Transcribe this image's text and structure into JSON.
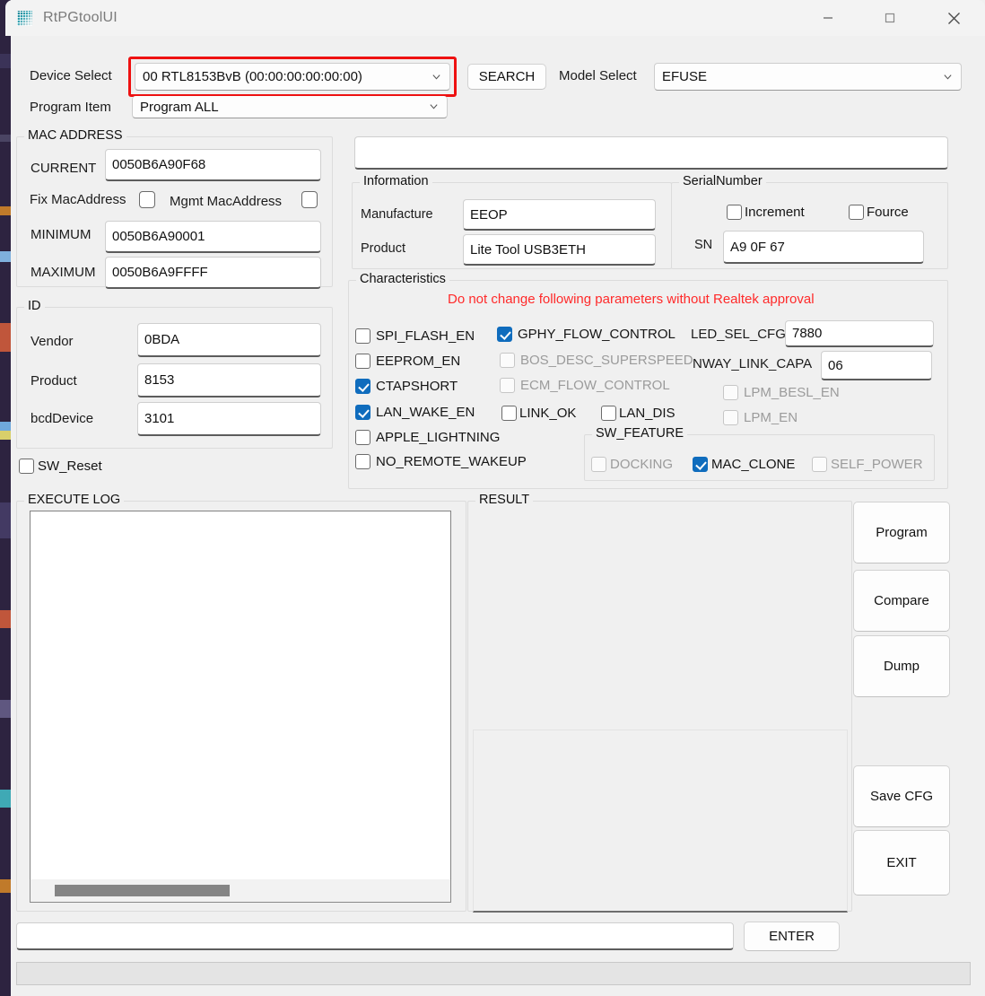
{
  "window": {
    "title": "RtPGtoolUI",
    "icon": "app-grid-icon",
    "controls": {
      "minimize": "—",
      "maximize": "☐",
      "close": "✕"
    }
  },
  "toolbar": {
    "device_select_label": "Device Select",
    "device_select_value": "00 RTL8153BvB (00:00:00:00:00:00)",
    "search_button": "SEARCH",
    "model_select_label": "Model Select",
    "model_select_value": "EFUSE",
    "program_item_label": "Program Item",
    "program_item_value": "Program ALL",
    "highlight_color": "#ee1111"
  },
  "mac_address": {
    "group_title": "MAC ADDRESS",
    "current_label": "CURRENT",
    "current_value": "0050B6A90F68",
    "fix_mac_label": "Fix MacAddress",
    "fix_mac_checked": false,
    "mgmt_mac_label": "Mgmt MacAddress",
    "mgmt_mac_checked": false,
    "minimum_label": "MINIMUM",
    "minimum_value": "0050B6A90001",
    "maximum_label": "MAXIMUM",
    "maximum_value": "0050B6A9FFFF"
  },
  "id": {
    "group_title": "ID",
    "vendor_label": "Vendor",
    "vendor_value": "0BDA",
    "product_label": "Product",
    "product_value": "8153",
    "bcddevice_label": "bcdDevice",
    "bcddevice_value": "3101"
  },
  "sw_reset": {
    "label": "SW_Reset",
    "checked": false
  },
  "top_field": {
    "value": ""
  },
  "information": {
    "group_title": "Information",
    "manufacture_label": "Manufacture",
    "manufacture_value": "EEOP",
    "product_label": "Product",
    "product_value": "Lite Tool USB3ETH"
  },
  "serial_number": {
    "group_title": "SerialNumber",
    "increment_label": "Increment",
    "increment_checked": false,
    "fource_label": "Fource",
    "fource_checked": false,
    "sn_label": "SN",
    "sn_value": "A9 0F 67"
  },
  "characteristics": {
    "group_title": "Characteristics",
    "warning": "Do not change following parameters without Realtek approval",
    "warning_color": "#ff2a2a",
    "accent_color": "#0f6cbd",
    "col1": [
      {
        "label": "SPI_FLASH_EN",
        "checked": false,
        "disabled": false
      },
      {
        "label": "EEPROM_EN",
        "checked": false,
        "disabled": false
      },
      {
        "label": "CTAPSHORT",
        "checked": true,
        "disabled": false
      },
      {
        "label": "LAN_WAKE_EN",
        "checked": true,
        "disabled": false
      },
      {
        "label": "APPLE_LIGHTNING",
        "checked": false,
        "disabled": false
      },
      {
        "label": "NO_REMOTE_WAKEUP",
        "checked": false,
        "disabled": false
      }
    ],
    "col2": [
      {
        "label": "GPHY_FLOW_CONTROL",
        "checked": true,
        "disabled": false
      },
      {
        "label": "BOS_DESC_SUPERSPEED",
        "checked": false,
        "disabled": true
      },
      {
        "label": "ECM_FLOW_CONTROL",
        "checked": false,
        "disabled": true
      }
    ],
    "link_ok": {
      "label": "LINK_OK",
      "checked": false,
      "disabled": false
    },
    "lan_dis": {
      "label": "LAN_DIS",
      "checked": false,
      "disabled": false
    },
    "led_sel_cfg_label": "LED_SEL_CFG",
    "led_sel_cfg_value": "7880",
    "nway_link_capa_label": "NWAY_LINK_CAPA",
    "nway_link_capa_value": "06",
    "lpm_besl_en": {
      "label": "LPM_BESL_EN",
      "checked": false,
      "disabled": true
    },
    "lpm_en": {
      "label": "LPM_EN",
      "checked": false,
      "disabled": true
    },
    "sw_feature": {
      "group_title": "SW_FEATURE",
      "items": [
        {
          "label": "DOCKING",
          "checked": false,
          "disabled": true
        },
        {
          "label": "MAC_CLONE",
          "checked": true,
          "disabled": false
        },
        {
          "label": "SELF_POWER",
          "checked": false,
          "disabled": true
        }
      ]
    }
  },
  "execute_log": {
    "group_title": "EXECUTE LOG",
    "content": ""
  },
  "result": {
    "group_title": "RESULT",
    "content": "",
    "sub_content": ""
  },
  "action_buttons": [
    {
      "label": "Program"
    },
    {
      "label": "Compare"
    },
    {
      "label": "Dump"
    },
    {
      "label": "Save CFG"
    },
    {
      "label": "EXIT"
    }
  ],
  "command_bar": {
    "value": "",
    "placeholder": "",
    "enter_label": "ENTER"
  },
  "status_bar": {
    "text": ""
  }
}
